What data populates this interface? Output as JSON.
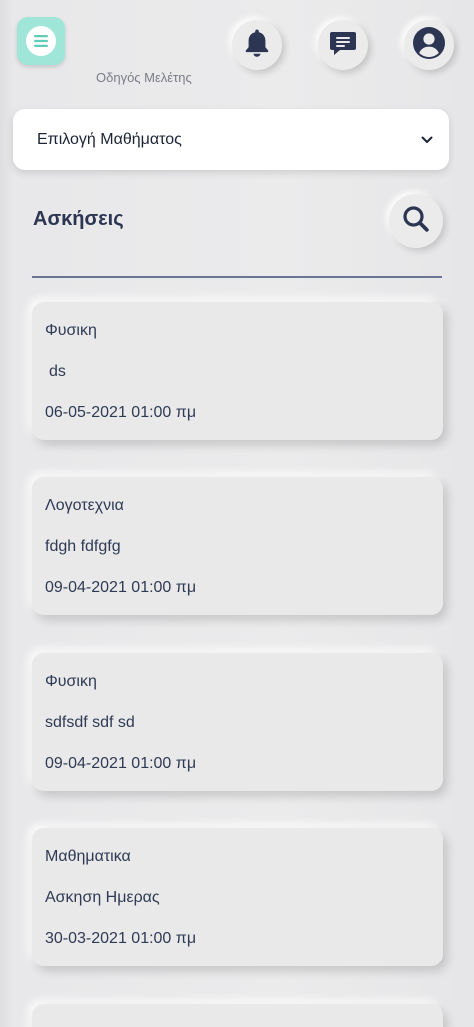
{
  "header": {
    "app_subtitle": "Οδηγός Μελέτης",
    "icons": [
      "menu-icon",
      "bell-icon",
      "chat-icon",
      "user-icon"
    ]
  },
  "course_select": {
    "label": "Επιλογή Μαθήματος"
  },
  "section": {
    "title": "Ασκήσεις"
  },
  "exercises": [
    {
      "subject": "Φυσικη",
      "title": "ds",
      "date": "06-05-2021 01:00 πμ"
    },
    {
      "subject": "Λογοτεχνια",
      "title": "fdgh fdfgfg",
      "date": "09-04-2021 01:00 πμ"
    },
    {
      "subject": "Φυσικη",
      "title": "sdfsdf sdf sd",
      "date": "09-04-2021 01:00 πμ"
    },
    {
      "subject": "Μαθηματικα",
      "title": "Ασκηση Ημερας",
      "date": "30-03-2021 01:00 πμ"
    }
  ],
  "colors": {
    "accent": "#9fe6d8",
    "text": "#2f3a54",
    "icon": "#2c3551",
    "background": "#e9e9ea"
  }
}
